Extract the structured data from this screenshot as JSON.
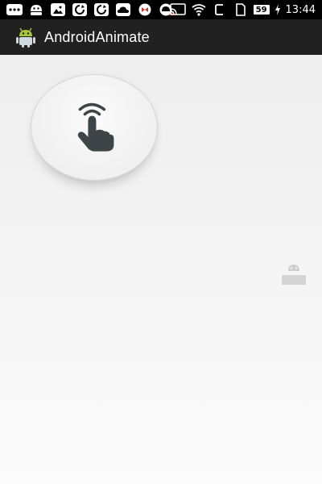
{
  "status_bar": {
    "left_icons": [
      "more-icon",
      "android-icon",
      "gallery-icon",
      "sync-icon",
      "sync-alt-icon",
      "cloud-icon",
      "game-icon",
      "android-alert-icon"
    ],
    "right_icons": [
      "cast-icon",
      "wifi-icon",
      "nfc-icon",
      "no-sim-icon"
    ],
    "battery_level": "59",
    "time": "13:44"
  },
  "app_bar": {
    "title": "AndroidAnimate",
    "icon": "android-robot-icon"
  },
  "main": {
    "press_button_icon": "tap-hand-icon"
  },
  "colors": {
    "status_bar_bg": "#000000",
    "app_bar_bg": "#212121",
    "hand": "#3d4548"
  }
}
